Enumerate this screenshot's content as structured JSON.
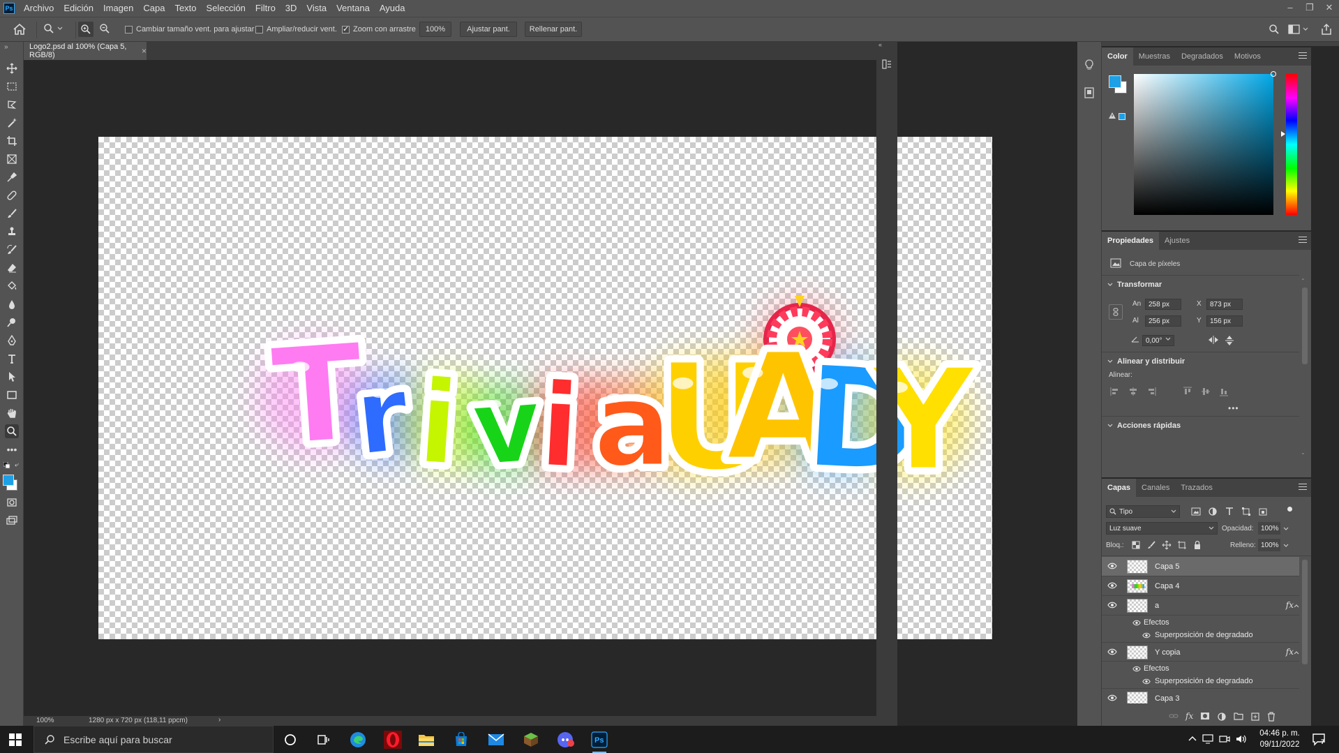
{
  "menubar": {
    "app_icon_text": "Ps",
    "items": [
      "Archivo",
      "Edición",
      "Imagen",
      "Capa",
      "Texto",
      "Selección",
      "Filtro",
      "3D",
      "Vista",
      "Ventana",
      "Ayuda"
    ]
  },
  "options": {
    "resize_window_label": "Cambiar tamaño vent. para ajustar",
    "resize_window_checked": false,
    "zoom_all_label": "Ampliar/reducir vent.",
    "zoom_all_checked": false,
    "scrubby_zoom_label": "Zoom con arrastre",
    "scrubby_zoom_checked": true,
    "zoom_value": "100%",
    "fit_screen_label": "Ajustar pant.",
    "fill_screen_label": "Rellenar pant."
  },
  "document": {
    "tab_title": "Logo2.psd al 100% (Capa 5, RGB/8)",
    "status_zoom": "100%",
    "status_info": "1280 px x 720 px (118,11 ppcm)",
    "logo_text": [
      "T",
      "r",
      "i",
      "v",
      "i",
      "a",
      "U",
      "A",
      "D",
      "Y"
    ],
    "logo_colors": [
      "#ff7bf2",
      "#2e6bff",
      "#c6f500",
      "#18d418",
      "#ff2d2d",
      "#ff5a1a",
      "#ffd000",
      "#ffc400",
      "#1a9bff",
      "#ffe000"
    ]
  },
  "color_panel": {
    "tabs": [
      "Color",
      "Muestras",
      "Degradados",
      "Motivos"
    ],
    "active_tab": "Color",
    "foreground": "#1ea0e6",
    "background": "#ffffff"
  },
  "properties_panel": {
    "tabs": [
      "Propiedades",
      "Ajustes"
    ],
    "active_tab": "Propiedades",
    "layer_type": "Capa de píxeles",
    "transform": {
      "title": "Transformar",
      "w_label": "An",
      "w_value": "258 px",
      "h_label": "Al",
      "h_value": "256 px",
      "x_label": "X",
      "x_value": "873 px",
      "y_label": "Y",
      "y_value": "156 px",
      "angle_value": "0,00°"
    },
    "align": {
      "title": "Alinear y distribuir",
      "align_label": "Alinear:"
    },
    "quick_actions": {
      "title": "Acciones rápidas"
    }
  },
  "layers_panel": {
    "tabs": [
      "Capas",
      "Canales",
      "Trazados"
    ],
    "active_tab": "Capas",
    "filter_label": "Tipo",
    "blend_mode": "Luz suave",
    "opacity_label": "Opacidad:",
    "opacity_value": "100%",
    "lock_label": "Bloq.:",
    "fill_label": "Relleno:",
    "fill_value": "100%",
    "layers": [
      {
        "name": "Capa 5",
        "selected": true,
        "fx": false
      },
      {
        "name": "Capa 4",
        "selected": false,
        "fx": false
      },
      {
        "name": "a",
        "selected": false,
        "fx": true,
        "effects_label": "Efectos",
        "effect": "Superposición de degradado"
      },
      {
        "name": "Y copia",
        "selected": false,
        "fx": true,
        "effects_label": "Efectos",
        "effect": "Superposición de degradado"
      },
      {
        "name": "Capa 3",
        "selected": false,
        "fx": false
      }
    ]
  },
  "taskbar": {
    "search_placeholder": "Escribe aquí para buscar",
    "time": "04:46 p. m.",
    "date": "09/11/2022",
    "notification_count": "7"
  }
}
